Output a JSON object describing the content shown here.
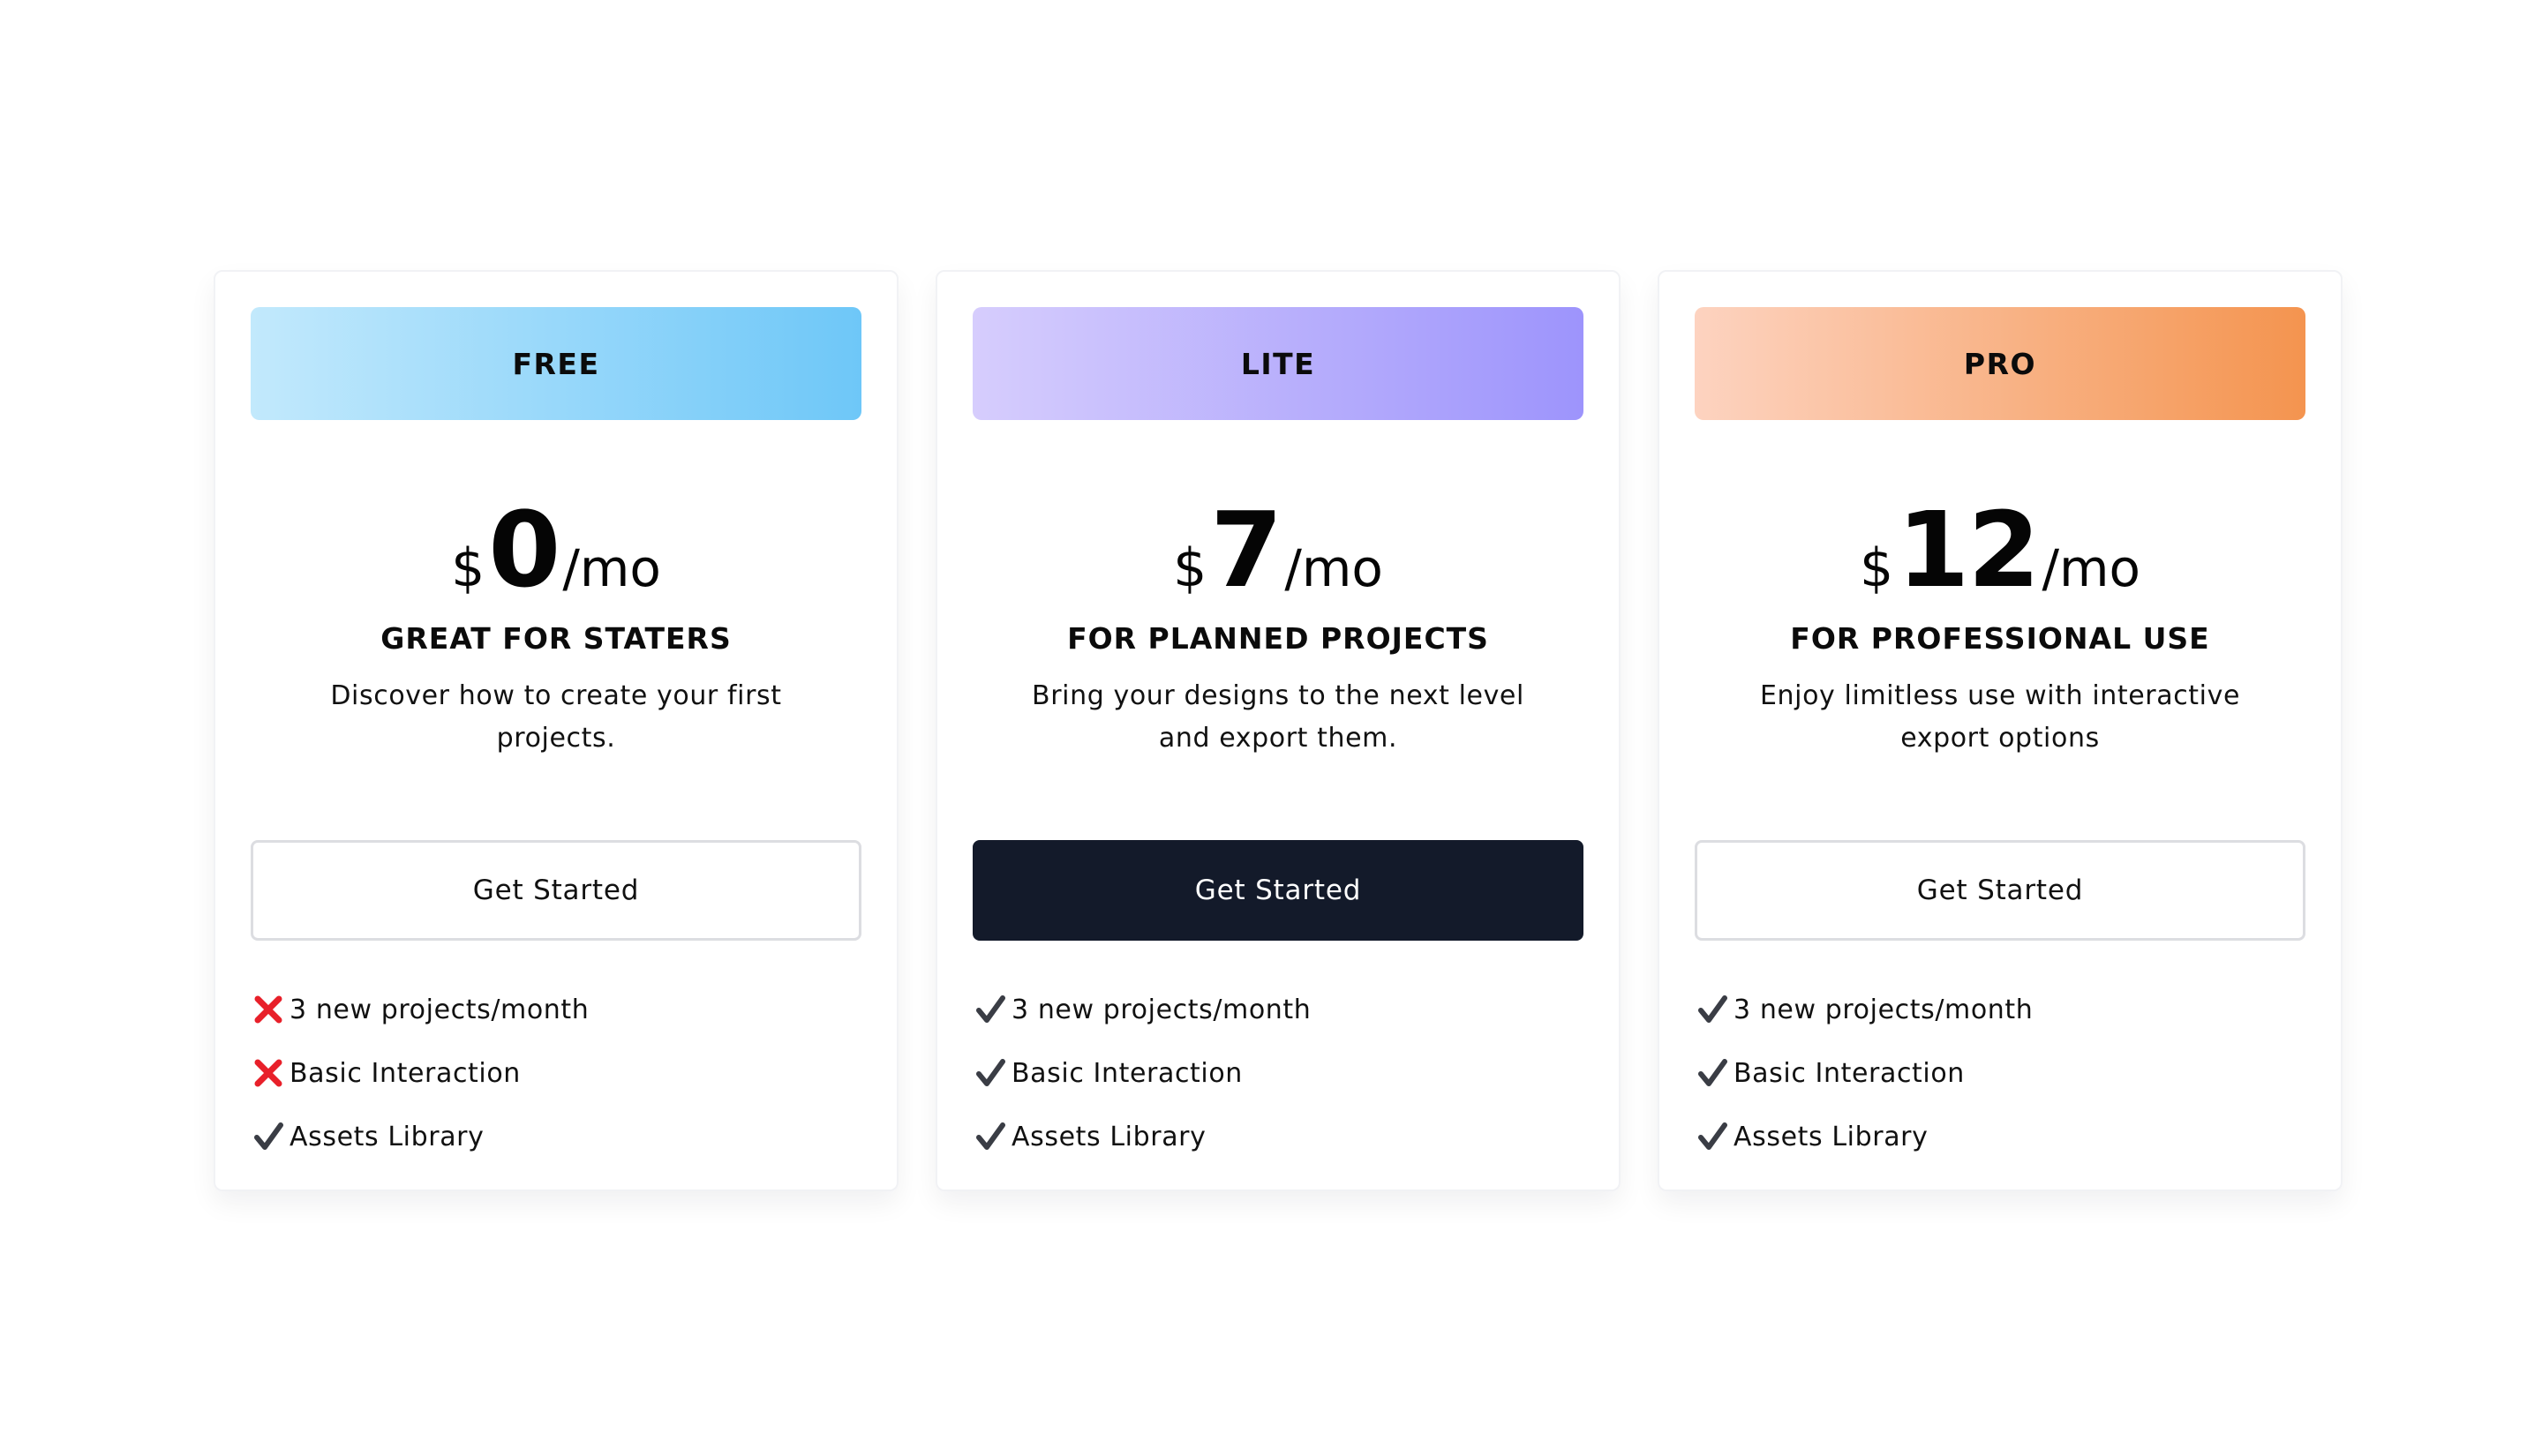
{
  "plans": [
    {
      "name": "FREE",
      "currency": "$",
      "amount": "0",
      "period": "/mo",
      "tagline": "GREAT FOR STATERS",
      "description": "Discover how to create your first projects.",
      "cta_label": "Get Started",
      "cta_style": "outline",
      "features": [
        {
          "label": "3 new projects/month",
          "included": false,
          "icon": "cross-icon"
        },
        {
          "label": "Basic Interaction",
          "included": false,
          "icon": "cross-icon"
        },
        {
          "label": "Assets Library",
          "included": true,
          "icon": "check-icon"
        }
      ]
    },
    {
      "name": "LITE",
      "currency": "$",
      "amount": "7",
      "period": "/mo",
      "tagline": "FOR PLANNED PROJECTS",
      "description": "Bring your designs to the next level and export them.",
      "cta_label": "Get Started",
      "cta_style": "solid",
      "features": [
        {
          "label": "3 new projects/month",
          "included": true,
          "icon": "check-icon"
        },
        {
          "label": "Basic Interaction",
          "included": true,
          "icon": "check-icon"
        },
        {
          "label": "Assets Library",
          "included": true,
          "icon": "check-icon"
        }
      ]
    },
    {
      "name": "PRO",
      "currency": "$",
      "amount": "12",
      "period": "/mo",
      "tagline": "FOR PROFESSIONAL USE",
      "description": "Enjoy limitless use with interactive export options",
      "cta_label": "Get Started",
      "cta_style": "outline",
      "features": [
        {
          "label": "3 new projects/month",
          "included": true,
          "icon": "check-icon"
        },
        {
          "label": "Basic Interaction",
          "included": true,
          "icon": "check-icon"
        },
        {
          "label": "Assets Library",
          "included": true,
          "icon": "check-icon"
        }
      ]
    }
  ],
  "colors": {
    "cta_solid_bg": "#131a2a",
    "cross": "#e8202a",
    "check": "#3a3d45",
    "free_gradient": [
      "#c2e9fc",
      "#6ec7f8"
    ],
    "lite_gradient": [
      "#d6cdfd",
      "#9d94fc"
    ],
    "pro_gradient": [
      "#fdd3c0",
      "#f4944f"
    ]
  }
}
